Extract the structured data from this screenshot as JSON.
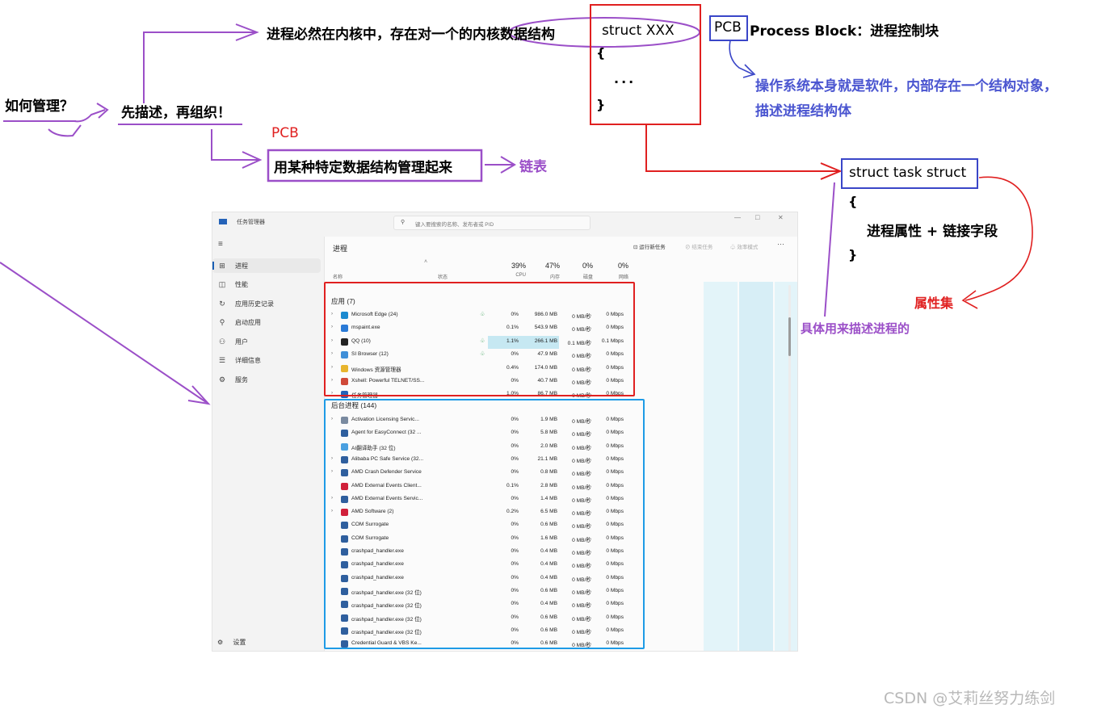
{
  "annotations": {
    "manage_q": "如何管理？",
    "describe_org": "先描述，再组织！",
    "kernel_struct": "进程必然在内核中，存在对一个的内核数据结构",
    "struct_xxx": "struct XXX",
    "brace_open": "{",
    "dots": "...",
    "brace_close": "}",
    "pcb_label": "PCB",
    "process_block": "Process Block：进程控制块",
    "os_software_line1": "操作系统本身就是软件，内部存在一个结构对象，",
    "os_software_line2": "描述进程结构体",
    "pcb_red": "PCB",
    "manage_struct": "用某种特定数据结构管理起来",
    "linked_list": "链表",
    "task_struct": "struct task struct",
    "task_brace_open": "{",
    "task_body": "进程属性 + 链接字段",
    "task_brace_close": "}",
    "attr_set": "属性集",
    "describe_process": "具体用来描述进程的",
    "watermark": "CSDN @艾莉丝努力练剑"
  },
  "taskmgr": {
    "app_title": "任务管理器",
    "search_placeholder": "键入要搜索的名称、发布者或 PID",
    "window_controls": {
      "min": "—",
      "max": "□",
      "close": "✕"
    },
    "menu_icon": "hamburger-icon",
    "sidebar": [
      {
        "icon": "processes-icon",
        "glyph": "⊞",
        "label": "进程",
        "active": true
      },
      {
        "icon": "performance-icon",
        "glyph": "◫",
        "label": "性能"
      },
      {
        "icon": "history-icon",
        "glyph": "↻",
        "label": "应用历史记录"
      },
      {
        "icon": "startup-icon",
        "glyph": "⚲",
        "label": "启动应用"
      },
      {
        "icon": "users-icon",
        "glyph": "⚇",
        "label": "用户"
      },
      {
        "icon": "details-icon",
        "glyph": "☰",
        "label": "详细信息"
      },
      {
        "icon": "services-icon",
        "glyph": "⚙",
        "label": "服务"
      }
    ],
    "settings_label": "设置",
    "section_title": "进程",
    "toolbar": {
      "run_task": "运行新任务",
      "end_task": "结束任务",
      "efficiency": "效率模式",
      "more": "···"
    },
    "columns": {
      "name": "名称",
      "status": "状态",
      "cpu_pct": "39%",
      "cpu": "CPU",
      "mem_pct": "47%",
      "mem": "内存",
      "disk_pct": "0%",
      "disk": "磁盘",
      "net_pct": "0%",
      "net": "网络"
    },
    "apps_group": "应用 (7)",
    "apps": [
      {
        "name": "Microsoft Edge (24)",
        "icon_color": "#1b8ad0",
        "leaf": true,
        "cpu": "0%",
        "mem": "986.0 MB",
        "disk": "0 MB/秒",
        "net": "0 Mbps"
      },
      {
        "name": "mspaint.exe",
        "icon_color": "#2a7ad6",
        "leaf": false,
        "cpu": "0.1%",
        "mem": "543.9 MB",
        "disk": "0 MB/秒",
        "net": "0 Mbps"
      },
      {
        "name": "QQ (10)",
        "icon_color": "#222222",
        "leaf": true,
        "cpu": "1.1%",
        "mem": "266.1 MB",
        "disk": "0.1 MB/秒",
        "net": "0.1 Mbps"
      },
      {
        "name": "SI Browser (12)",
        "icon_color": "#3f8fd8",
        "leaf": true,
        "cpu": "0%",
        "mem": "47.9 MB",
        "disk": "0 MB/秒",
        "net": "0 Mbps"
      },
      {
        "name": "Windows 资源管理器",
        "icon_color": "#e8b52e",
        "leaf": false,
        "cpu": "0.4%",
        "mem": "174.0 MB",
        "disk": "0 MB/秒",
        "net": "0 Mbps"
      },
      {
        "name": "Xshell: Powerful TELNET/SS...",
        "icon_color": "#d04a3a",
        "leaf": false,
        "cpu": "0%",
        "mem": "40.7 MB",
        "disk": "0 MB/秒",
        "net": "0 Mbps"
      },
      {
        "name": "任务管理器",
        "icon_color": "#2563b8",
        "leaf": false,
        "cpu": "1.0%",
        "mem": "86.7 MB",
        "disk": "0 MB/秒",
        "net": "0 Mbps"
      }
    ],
    "bg_group": "后台进程 (144)",
    "background": [
      {
        "name": "Activation Licensing Servic...",
        "exp": true,
        "icon_color": "#7a8aa0",
        "cpu": "0%",
        "mem": "1.9 MB",
        "disk": "0 MB/秒",
        "net": "0 Mbps"
      },
      {
        "name": "Agent for EasyConnect (32 ...",
        "exp": false,
        "icon_color": "#2f5f9e",
        "cpu": "0%",
        "mem": "5.8 MB",
        "disk": "0 MB/秒",
        "net": "0 Mbps"
      },
      {
        "name": "AI翻译助手 (32 位)",
        "exp": false,
        "icon_color": "#4aa0e0",
        "cpu": "0%",
        "mem": "2.0 MB",
        "disk": "0 MB/秒",
        "net": "0 Mbps"
      },
      {
        "name": "Alibaba PC Safe Service (32...",
        "exp": true,
        "icon_color": "#2f5f9e",
        "cpu": "0%",
        "mem": "21.1 MB",
        "disk": "0 MB/秒",
        "net": "0 Mbps"
      },
      {
        "name": "AMD Crash Defender Service",
        "exp": true,
        "icon_color": "#2f5f9e",
        "cpu": "0%",
        "mem": "0.8 MB",
        "disk": "0 MB/秒",
        "net": "0 Mbps"
      },
      {
        "name": "AMD External Events Client...",
        "exp": false,
        "icon_color": "#d0203a",
        "cpu": "0.1%",
        "mem": "2.8 MB",
        "disk": "0 MB/秒",
        "net": "0 Mbps"
      },
      {
        "name": "AMD External Events Servic...",
        "exp": true,
        "icon_color": "#2f5f9e",
        "cpu": "0%",
        "mem": "1.4 MB",
        "disk": "0 MB/秒",
        "net": "0 Mbps"
      },
      {
        "name": "AMD Software (2)",
        "exp": true,
        "icon_color": "#d0203a",
        "cpu": "0.2%",
        "mem": "6.5 MB",
        "disk": "0 MB/秒",
        "net": "0 Mbps"
      },
      {
        "name": "COM Surrogate",
        "exp": false,
        "icon_color": "#2f5f9e",
        "cpu": "0%",
        "mem": "0.6 MB",
        "disk": "0 MB/秒",
        "net": "0 Mbps"
      },
      {
        "name": "COM Surrogate",
        "exp": false,
        "icon_color": "#2f5f9e",
        "cpu": "0%",
        "mem": "1.6 MB",
        "disk": "0 MB/秒",
        "net": "0 Mbps"
      },
      {
        "name": "crashpad_handler.exe",
        "exp": false,
        "icon_color": "#2f5f9e",
        "cpu": "0%",
        "mem": "0.4 MB",
        "disk": "0 MB/秒",
        "net": "0 Mbps"
      },
      {
        "name": "crashpad_handler.exe",
        "exp": false,
        "icon_color": "#2f5f9e",
        "cpu": "0%",
        "mem": "0.4 MB",
        "disk": "0 MB/秒",
        "net": "0 Mbps"
      },
      {
        "name": "crashpad_handler.exe",
        "exp": false,
        "icon_color": "#2f5f9e",
        "cpu": "0%",
        "mem": "0.4 MB",
        "disk": "0 MB/秒",
        "net": "0 Mbps"
      },
      {
        "name": "crashpad_handler.exe (32 位)",
        "exp": false,
        "icon_color": "#2f5f9e",
        "cpu": "0%",
        "mem": "0.6 MB",
        "disk": "0 MB/秒",
        "net": "0 Mbps"
      },
      {
        "name": "crashpad_handler.exe (32 位)",
        "exp": false,
        "icon_color": "#2f5f9e",
        "cpu": "0%",
        "mem": "0.4 MB",
        "disk": "0 MB/秒",
        "net": "0 Mbps"
      },
      {
        "name": "crashpad_handler.exe (32 位)",
        "exp": false,
        "icon_color": "#2f5f9e",
        "cpu": "0%",
        "mem": "0.6 MB",
        "disk": "0 MB/秒",
        "net": "0 Mbps"
      },
      {
        "name": "crashpad_handler.exe (32 位)",
        "exp": false,
        "icon_color": "#2f5f9e",
        "cpu": "0%",
        "mem": "0.6 MB",
        "disk": "0 MB/秒",
        "net": "0 Mbps"
      },
      {
        "name": "Credential Guard & VBS Ke...",
        "exp": false,
        "icon_color": "#2f5f9e",
        "cpu": "0%",
        "mem": "0.6 MB",
        "disk": "0 MB/秒",
        "net": "0 Mbps"
      }
    ]
  },
  "colors": {
    "purple": "#9b4fc8",
    "red": "#e02020",
    "blue": "#3a46c8",
    "cyan_box": "#1e9be6",
    "heat": "#e3f4f9",
    "heat_strong": "#c6e8f2"
  }
}
